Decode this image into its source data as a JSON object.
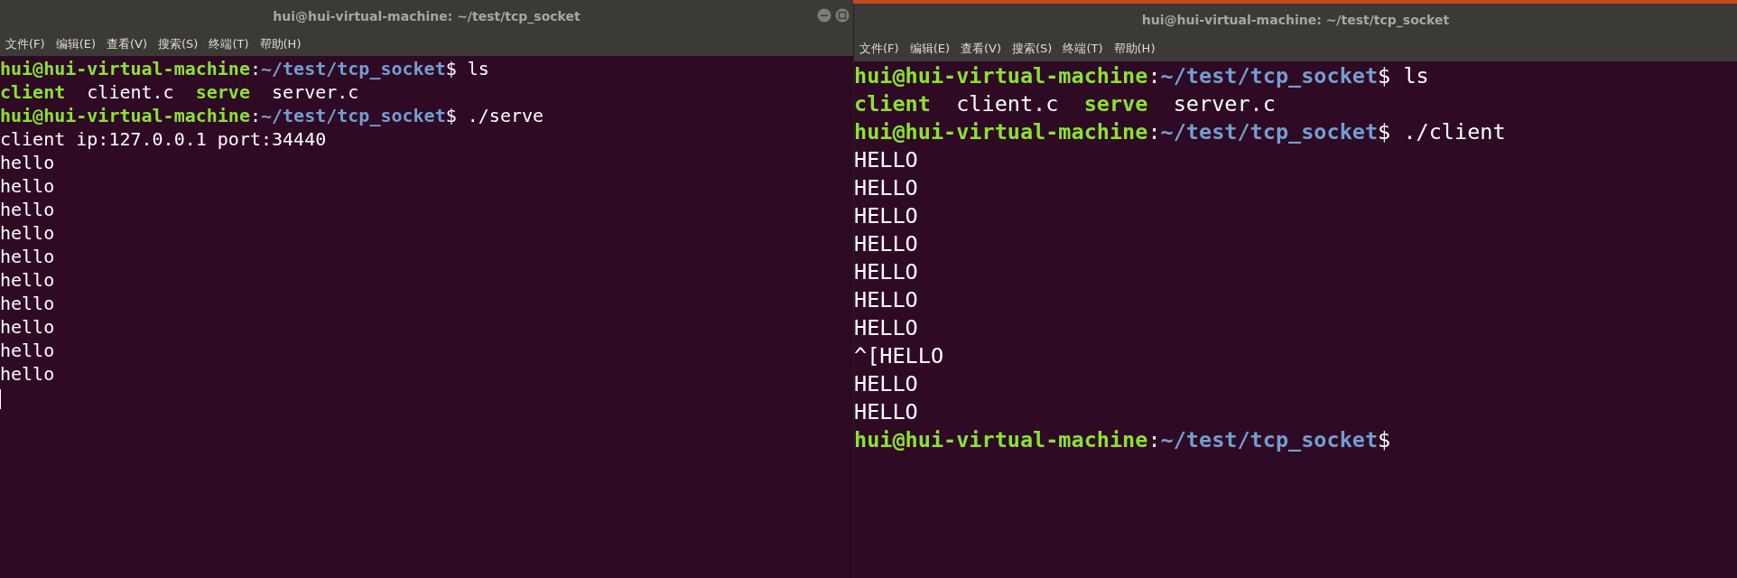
{
  "windows": [
    {
      "title": "hui@hui-virtual-machine: ~/test/tcp_socket",
      "cursor": true,
      "menu": [
        "文件(F)",
        "编辑(E)",
        "查看(V)",
        "搜索(S)",
        "终端(T)",
        "帮助(H)"
      ],
      "lines": [
        [
          {
            "kind": "user",
            "text": "hui@hui-virtual-machine"
          },
          {
            "kind": "plain",
            "text": ":"
          },
          {
            "kind": "path",
            "text": "~/test/tcp_socket"
          },
          {
            "kind": "plain",
            "text": "$ ls"
          }
        ],
        [
          {
            "kind": "exec",
            "text": "client"
          },
          {
            "kind": "plain",
            "text": "  client.c  "
          },
          {
            "kind": "exec",
            "text": "serve"
          },
          {
            "kind": "plain",
            "text": "  server.c"
          }
        ],
        [
          {
            "kind": "user",
            "text": "hui@hui-virtual-machine"
          },
          {
            "kind": "plain",
            "text": ":"
          },
          {
            "kind": "path",
            "text": "~/test/tcp_socket"
          },
          {
            "kind": "plain",
            "text": "$ ./serve"
          }
        ],
        [
          {
            "kind": "plain",
            "text": "client ip:127.0.0.1 port:34440"
          }
        ],
        [
          {
            "kind": "plain",
            "text": "hello"
          }
        ],
        [
          {
            "kind": "plain",
            "text": "hello"
          }
        ],
        [
          {
            "kind": "plain",
            "text": "hello"
          }
        ],
        [
          {
            "kind": "plain",
            "text": "hello"
          }
        ],
        [
          {
            "kind": "plain",
            "text": "hello"
          }
        ],
        [
          {
            "kind": "plain",
            "text": "hello"
          }
        ],
        [
          {
            "kind": "plain",
            "text": "hello"
          }
        ],
        [
          {
            "kind": "plain",
            "text": "hello"
          }
        ],
        [
          {
            "kind": "plain",
            "text": "hello"
          }
        ],
        [
          {
            "kind": "plain",
            "text": "hello"
          }
        ]
      ]
    },
    {
      "title": "hui@hui-virtual-machine: ~/test/tcp_socket",
      "cursor": false,
      "menu": [
        "文件(F)",
        "编辑(E)",
        "查看(V)",
        "搜索(S)",
        "终端(T)",
        "帮助(H)"
      ],
      "lines": [
        [
          {
            "kind": "user",
            "text": "hui@hui-virtual-machine"
          },
          {
            "kind": "plain",
            "text": ":"
          },
          {
            "kind": "path",
            "text": "~/test/tcp_socket"
          },
          {
            "kind": "plain",
            "text": "$ ls"
          }
        ],
        [
          {
            "kind": "exec",
            "text": "client"
          },
          {
            "kind": "plain",
            "text": "  client.c  "
          },
          {
            "kind": "exec",
            "text": "serve"
          },
          {
            "kind": "plain",
            "text": "  server.c"
          }
        ],
        [
          {
            "kind": "user",
            "text": "hui@hui-virtual-machine"
          },
          {
            "kind": "plain",
            "text": ":"
          },
          {
            "kind": "path",
            "text": "~/test/tcp_socket"
          },
          {
            "kind": "plain",
            "text": "$ ./client"
          }
        ],
        [
          {
            "kind": "plain",
            "text": "HELLO"
          }
        ],
        [
          {
            "kind": "plain",
            "text": "HELLO"
          }
        ],
        [
          {
            "kind": "plain",
            "text": "HELLO"
          }
        ],
        [
          {
            "kind": "plain",
            "text": "HELLO"
          }
        ],
        [
          {
            "kind": "plain",
            "text": "HELLO"
          }
        ],
        [
          {
            "kind": "plain",
            "text": "HELLO"
          }
        ],
        [
          {
            "kind": "plain",
            "text": "HELLO"
          }
        ],
        [
          {
            "kind": "plain",
            "text": "^[HELLO"
          }
        ],
        [
          {
            "kind": "plain",
            "text": "HELLO"
          }
        ],
        [
          {
            "kind": "plain",
            "text": "HELLO"
          }
        ],
        [
          {
            "kind": "user",
            "text": "hui@hui-virtual-machine"
          },
          {
            "kind": "plain",
            "text": ":"
          },
          {
            "kind": "path",
            "text": "~/test/tcp_socket"
          },
          {
            "kind": "plain",
            "text": "$"
          }
        ]
      ]
    }
  ]
}
